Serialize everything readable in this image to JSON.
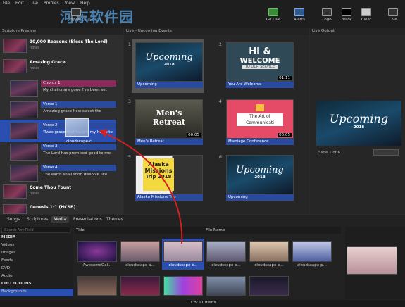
{
  "menu": [
    "File",
    "Edit",
    "Live",
    "Profiles",
    "View",
    "Help"
  ],
  "toolbar": {
    "go_live": "Go Live",
    "alerts": "Alerts",
    "logo": "Logo",
    "black": "Black",
    "clear": "Clear",
    "live": "Live",
    "show": "Show"
  },
  "watermark": {
    "title": "河东软件园",
    "url": "www.pc0359.cn"
  },
  "left": {
    "header": "Scripture Preview",
    "songs": [
      {
        "title": "10,000 Reasons (Bless The Lord)",
        "sub": "notes"
      },
      {
        "title": "Amazing Grace",
        "sub": "notes"
      }
    ],
    "slides": [
      {
        "label": "Chorus 1",
        "text": "My chains are gone I've been set",
        "color": "#8a2a5a"
      },
      {
        "label": "Verse 1",
        "text": "Amazing grace how sweet the",
        "color": "#2a4aa0"
      },
      {
        "label": "Verse 2",
        "text": "'Twas grace that taught my heart to",
        "color": "#2a4aa0"
      },
      {
        "label": "Verse 3",
        "text": "The Lord has promised good to me",
        "color": "#2a4aa0"
      },
      {
        "label": "Verse 4",
        "text": "The earth shall soon dissolve like",
        "color": "#2a4aa0"
      }
    ],
    "drag_label": "cloudscape-c...",
    "more": [
      {
        "title": "Come Thou Fount",
        "sub": "notes"
      },
      {
        "title": "Genesis 1:1 (HCSB)",
        "sub": ""
      }
    ]
  },
  "mid": {
    "header": "Live - Upcoming Events",
    "cells": [
      {
        "num": "1",
        "caption": "Upcoming",
        "kind": "upcoming",
        "time": ""
      },
      {
        "num": "2",
        "caption": "You Are Welcome",
        "kind": "welcome",
        "time": "01:11"
      },
      {
        "num": "3",
        "caption": "Men's Retreat",
        "kind": "men",
        "time": "00:05"
      },
      {
        "num": "4",
        "caption": "Marriage Conference",
        "kind": "marriage",
        "time": "00:05"
      },
      {
        "num": "5",
        "caption": "Alaska Missions Trip",
        "kind": "alaska",
        "time": ""
      },
      {
        "num": "6",
        "caption": "Upcoming",
        "kind": "upcoming",
        "time": ""
      }
    ],
    "upcoming_word": "Upcoming",
    "year": "2018",
    "welcome": {
      "hi": "HI &",
      "w": "WELCOME",
      "sub": "TO OUR SERVICE"
    },
    "men": {
      "a": "Men's",
      "b": "Retreat"
    },
    "marriage": {
      "a": "The Art of",
      "b": "Communicati"
    },
    "alaska": {
      "a": "Alaska",
      "b": "Missions",
      "c": "Trip 2018"
    }
  },
  "right": {
    "header": "Live Output",
    "slide_info": "Slide 1 of 6"
  },
  "bottom": {
    "tabs": [
      "Songs",
      "Scriptures",
      "Media",
      "Presentations",
      "Themes"
    ],
    "active_tab": "Media",
    "search_placeholder": "Search Any Field",
    "tree": {
      "media": "MEDIA",
      "items": [
        "Videos",
        "Images",
        "Feeds",
        "DVD",
        "Audio"
      ],
      "collections": "COLLECTIONS",
      "coll_items": [
        "Backgrounds"
      ]
    },
    "col_title": "Title",
    "col_file": "File Name",
    "thumbs": [
      "AwesomeGal...",
      "cloudscape-a...",
      "cloudscape-c...",
      "cloudscape-c...",
      "cloudscape-c...",
      "cloudscape-p..."
    ],
    "footer": "1 of 11 items"
  },
  "colors": {
    "accent": "#2a4aa0",
    "chorus": "#8a2a5a",
    "arrow": "#d42020"
  }
}
